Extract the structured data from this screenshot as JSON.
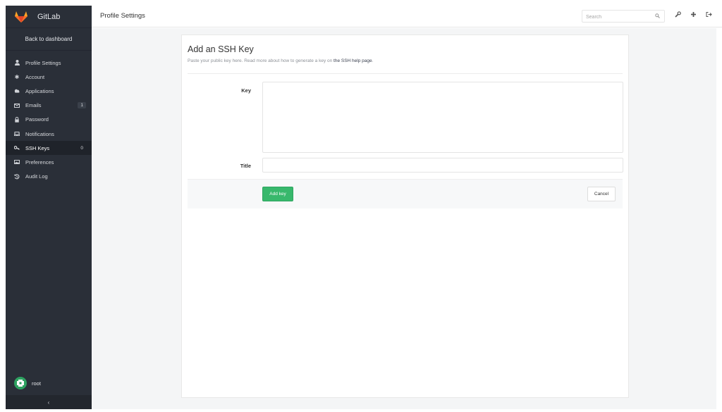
{
  "app": {
    "name": "GitLab",
    "logo_icon": "gitlab-fox-icon",
    "logo_color": "#e2432a"
  },
  "sidebar": {
    "back_label": "Back to dashboard",
    "items": [
      {
        "label": "Profile Settings",
        "icon": "user-icon"
      },
      {
        "label": "Account",
        "icon": "gear-icon"
      },
      {
        "label": "Applications",
        "icon": "cloud-icon"
      },
      {
        "label": "Emails",
        "icon": "envelope-icon",
        "count": "1"
      },
      {
        "label": "Password",
        "icon": "lock-icon"
      },
      {
        "label": "Notifications",
        "icon": "inbox-icon"
      },
      {
        "label": "SSH Keys",
        "icon": "key-icon",
        "count": "0",
        "active": true
      },
      {
        "label": "Preferences",
        "icon": "image-icon"
      },
      {
        "label": "Audit Log",
        "icon": "history-icon"
      }
    ],
    "user": {
      "name": "root"
    },
    "collapse_glyph": "‹"
  },
  "header": {
    "title": "Profile Settings",
    "search": {
      "placeholder": "Search",
      "value": ""
    },
    "icons": [
      "wrench-icon",
      "plus-icon",
      "sign-out-icon"
    ]
  },
  "main": {
    "title": "Add an SSH Key",
    "subtitle_prefix": "Paste your public key here. Read more about how to generate a key on ",
    "subtitle_link": "the SSH help page",
    "subtitle_suffix": ".",
    "key_label": "Key",
    "key_value": "",
    "title_label": "Title",
    "title_value": "",
    "add_button": "Add key",
    "cancel_button": "Cancel"
  },
  "colors": {
    "sidebar_bg": "#2a2f38",
    "active_bg": "#1f232a",
    "accent_green": "#38b86c",
    "page_bg": "#f4f5f6"
  }
}
